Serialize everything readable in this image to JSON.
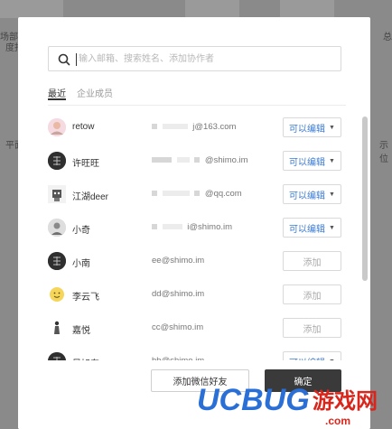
{
  "background": {
    "page_text_1": "场部管",
    "page_text_2": "度报",
    "page_text_3": "平面",
    "page_text_4": "示位",
    "page_text_5": "总"
  },
  "search": {
    "placeholder": "输入邮箱、搜索姓名、添加协作者",
    "value": ""
  },
  "tabs": [
    {
      "label": "最近",
      "active": true
    },
    {
      "label": "企业成员",
      "active": false
    }
  ],
  "members": [
    {
      "name": "retow",
      "email": "j@163.com",
      "action": "可以编辑",
      "type": "edit",
      "avatar": "avatar-pink"
    },
    {
      "name": "许旺旺",
      "email": "@shimo.im",
      "action": "可以编辑",
      "type": "edit",
      "avatar": "avatar-dark"
    },
    {
      "name": "江湖deer",
      "email": "@qq.com",
      "action": "可以编辑",
      "type": "edit",
      "avatar": "avatar-robot"
    },
    {
      "name": "小奇",
      "email": "i@shimo.im",
      "action": "可以编辑",
      "type": "edit",
      "avatar": "avatar-grey"
    },
    {
      "name": "小南",
      "email": "ee@shimo.im",
      "action": "添加",
      "type": "add",
      "avatar": "avatar-dark"
    },
    {
      "name": "李云飞",
      "email": "dd@shimo.im",
      "action": "添加",
      "type": "add",
      "avatar": "avatar-smile"
    },
    {
      "name": "嘉悦",
      "email": "cc@shimo.im",
      "action": "添加",
      "type": "add",
      "avatar": "avatar-figure"
    },
    {
      "name": "吴旭东",
      "email": "bb@shimo.im",
      "action": "可以编辑",
      "type": "edit",
      "avatar": "avatar-dark"
    }
  ],
  "footer": {
    "wechat_label": "添加微信好友",
    "confirm_label": "确定"
  },
  "watermark": {
    "brand": "UCBUG",
    "cn": "游戏网",
    "domain": ".com"
  },
  "colors": {
    "edit": "#3a7bd5",
    "confirm": "#3a3a3a",
    "watermark_blue": "#2a6fd6",
    "watermark_red": "#d9261c"
  }
}
